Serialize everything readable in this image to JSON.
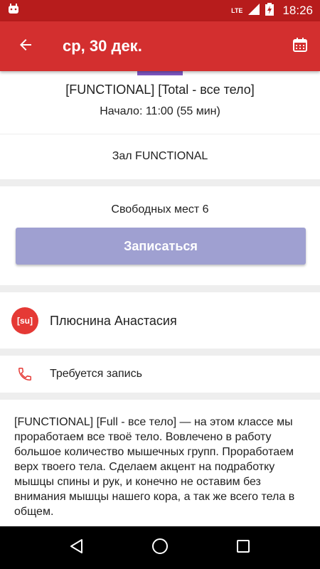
{
  "status_bar": {
    "network_label": "LTE",
    "time": "18:26",
    "icons": [
      "android-notification-icon",
      "signal-icon",
      "battery-charging-icon"
    ]
  },
  "app_bar": {
    "title": "ср, 30 дек.",
    "back_icon": "arrow-left-icon",
    "calendar_icon": "calendar-icon",
    "background_color": "#d32f2f"
  },
  "class_info": {
    "title": "[FUNCTIONAL] [Total - все тело]",
    "start": "Начало: 11:00 (55 мин)",
    "hall": "Зал FUNCTIONAL"
  },
  "booking": {
    "free_seats": "Свободных мест 6",
    "signup_label": "Записаться",
    "button_color": "#9fa0d1"
  },
  "trainer": {
    "name": "Плюснина Анастасия",
    "avatar_text": "[su]",
    "avatar_color": "#e53935"
  },
  "contact": {
    "label": "Требуется запись",
    "icon": "phone-icon"
  },
  "description": "[FUNCTIONAL] [Full - все тело] — на этом классе мы проработаем все твоё тело. Вовлечено в работу большое количество мышечных групп. Проработаем верх твоего тела. Сделаем акцент на подработку мышцы спины и рук, и конечно не оставим без внимания мышцы нашего кора, а так же всего тела в общем.",
  "nav_bar": {
    "icons": [
      "back-triangle-icon",
      "home-circle-icon",
      "recents-square-icon"
    ]
  }
}
